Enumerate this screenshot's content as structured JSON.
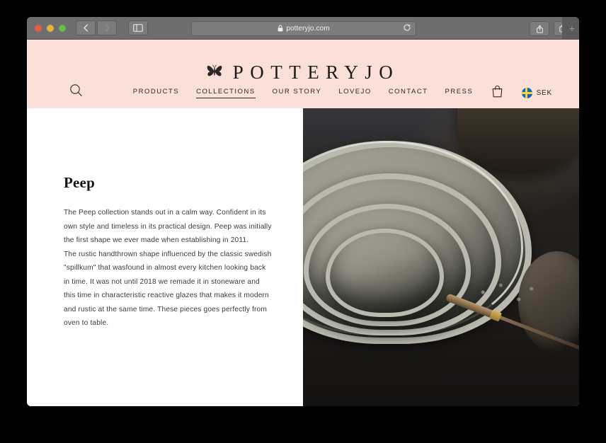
{
  "browser": {
    "url": "potteryjo.com",
    "lock_icon": "padlock-icon",
    "reload_icon": "reload-icon",
    "back_icon": "chevron-left-icon",
    "forward_icon": "chevron-right-icon",
    "sidebar_icon": "sidebar-toggle-icon",
    "share_icon": "share-icon",
    "tabs_icon": "tab-overview-icon",
    "newtab_label": "+",
    "traffic_lights": {
      "close": "close-window-button",
      "minimize": "minimize-window-button",
      "zoom": "zoom-window-button"
    }
  },
  "site": {
    "logo_mark": "butterfly-icon",
    "wordmark": "POTTERYJO",
    "search_icon": "search-icon",
    "cart_icon": "shopping-bag-icon",
    "currency": {
      "flag": "sweden-flag-icon",
      "code": "SEK"
    },
    "nav": [
      {
        "label": "PRODUCTS",
        "active": false
      },
      {
        "label": "COLLECTIONS",
        "active": true
      },
      {
        "label": "OUR STORY",
        "active": false
      },
      {
        "label": "LOVEJO",
        "active": false
      },
      {
        "label": "CONTACT",
        "active": false
      },
      {
        "label": "PRESS",
        "active": false
      }
    ]
  },
  "collection": {
    "title": "Peep",
    "paragraph_1": "The Peep collection stands out in a calm way. Confident in its own style and timeless in its practical design. Peep was initially the first shape we ever made when establishing in 2011.",
    "paragraph_2": "The  rustic handthrown shape influenced by the classic swedish \"spillkum\" that wasfound in almost every kitchen looking back in time. It was not until 2018 we remade it in stoneware and this time in characteristic reactive glazes that makes it modern and rustic at the same time. These pieces goes perfectly from oven to table.",
    "photo_alt": "nested-grey-ceramic-bowls-with-pottery-tool"
  },
  "colors": {
    "header_pink": "#FAE0D8",
    "text_dark": "#3B3B3B",
    "title_dark": "#141414",
    "toolbar_grey": "#6E6E6E",
    "flag_blue": "#0D6BB6",
    "flag_yellow": "#FDCF3D"
  }
}
